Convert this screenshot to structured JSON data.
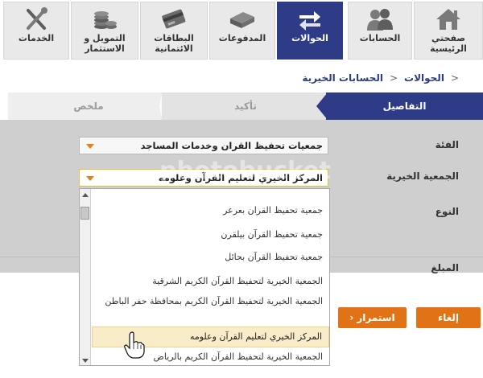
{
  "nav": {
    "items": [
      {
        "label": "صفحتي الرئيسية",
        "icon": "home-icon"
      },
      {
        "label": "الحسابات",
        "icon": "users-icon"
      },
      {
        "label": "الحوالات",
        "icon": "transfer-icon",
        "active": true
      },
      {
        "label": "المدفوعات",
        "icon": "payments-icon"
      },
      {
        "label": "البطاقات الائتمانية",
        "icon": "credit-card-icon"
      },
      {
        "label": "التمويل و الاستثمار",
        "icon": "coins-icon"
      },
      {
        "label": "الخدمات",
        "icon": "tools-icon"
      }
    ]
  },
  "breadcrumb": {
    "separator": "<",
    "transfers": "الحوالات",
    "charity": "الحسابات الخيرية"
  },
  "steps": {
    "details": "التفاصيل",
    "confirm": "تأكيد",
    "summary": "ملخص"
  },
  "form": {
    "category_label": "الفئة",
    "category_value": "جمعيات تحفيظ القران وخدمات المساجد",
    "charity_label": "الجمعية الخيرية",
    "charity_value": "المركز الخيري لتعليم القرآن وعلومه",
    "type_label": "النوع",
    "amount_label": "المبلغ"
  },
  "dropdown": {
    "options": [
      "جمعية تحفيظ القران بعرعر",
      "جمعية تحفيظ القرآن بيلقرن",
      "جمعية تحفيظ القرآن بحائل",
      "الجمعية الخيرية لتحفيظ القرآن الكريم الشرقية",
      "الجمعية الخيرية لتحفيظ القرآن الكريم بمحافظة حفر الباطن",
      "المركز الخيري لتعليم القرآن وعلومه",
      "الجمعية الخيرية لتحفيظ القرآن الكريم بالرياض"
    ],
    "selected_index": 5
  },
  "buttons": {
    "cancel": "إلغاء",
    "continue": "استمرار",
    "continue_arrow": "‹"
  },
  "watermark": "photobucket",
  "colors": {
    "navy": "#2e3b86",
    "orange": "#e27216",
    "highlight": "#f8edc8"
  }
}
